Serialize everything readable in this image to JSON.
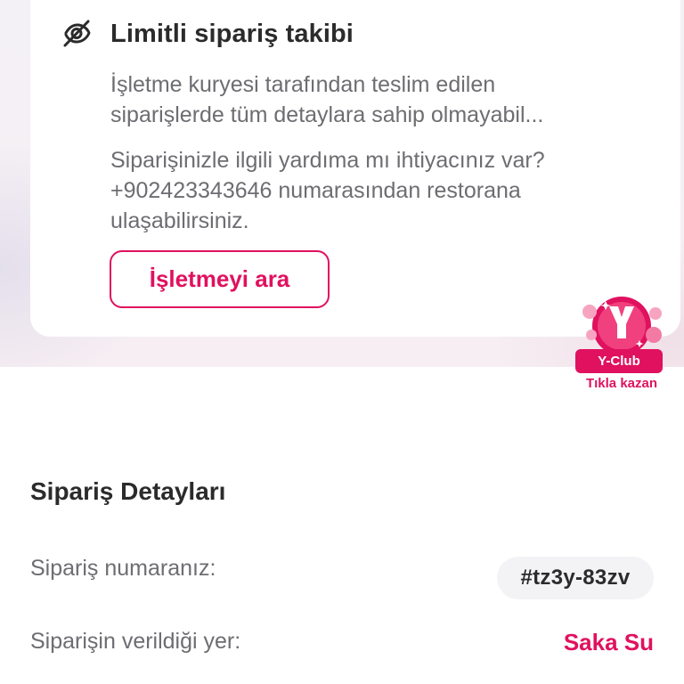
{
  "tracking_card": {
    "title": "Limitli sipariş takibi",
    "icon": "eye-off-icon",
    "description_line1": "İşletme kuryesi tarafından teslim edilen",
    "description_line2": "siparişlerde tüm detaylara sahip olmayabil...",
    "help_line1": "Siparişinizle ilgili yardıma mı ihtiyacınız var?",
    "help_line2": "+902423343646 numarasından restorana",
    "help_line3": "ulaşabilirsiniz.",
    "call_button": "İşletmeyi ara"
  },
  "yclub": {
    "logo_letter": "Y",
    "label": "Y-Club",
    "cta": "Tıkla kazan"
  },
  "order_details": {
    "title": "Sipariş Detayları",
    "order_number_label": "Sipariş numaranız:",
    "order_number": "#tz3y-83zv",
    "place_label": "Siparişin verildiği yer:",
    "place_value": "Saka Su"
  },
  "colors": {
    "accent": "#e0115f",
    "text_primary": "#2b2b2b",
    "text_secondary": "#6d6d72"
  }
}
